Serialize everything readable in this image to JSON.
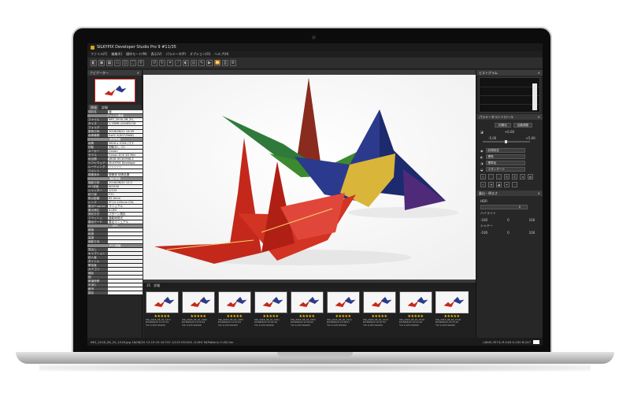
{
  "app": {
    "title": "SILKYPIX Developer Studio Pro 9  #11/35",
    "menu": [
      "ファイル(F)",
      "編集(E)",
      "操作モード(M)",
      "表示(V)",
      "パラメータ(P)",
      "オプション(O)",
      "ヘルプ(H)"
    ]
  },
  "left": {
    "navigator_title": "ナビゲーター",
    "tabs": [
      "情報",
      "詳細"
    ],
    "info": [
      {
        "k": "項目名",
        "v": "値"
      },
      {
        "section": "ファイル情報"
      },
      {
        "k": "ファイル",
        "v": "IMG_2018_08_20_"
      },
      {
        "k": "サイズ",
        "v": "2.30MB (24085216"
      },
      {
        "k": "フォルダ",
        "v": ""
      },
      {
        "k": "更新日時",
        "v": "2018/08/21 14:09"
      },
      {
        "k": "画像種類",
        "v": "Exif2.3(DCF/RAW)"
      },
      {
        "section": "基礎情報"
      },
      {
        "k": "画素",
        "v": "5616 x 3744 (マナ"
      },
      {
        "k": "回転",
        "v": "回転なし (1)"
      },
      {
        "k": "メーカー",
        "v": "Canon"
      },
      {
        "k": "モデル",
        "v": "Canon EOS 5D Mar"
      },
      {
        "k": "色空間",
        "v": "sRGB IEC61966-2"
      },
      {
        "k": "ソフトウェア",
        "v": "SILKYPIX Develope"
      },
      {
        "k": "レーティング",
        "v": "☆☆☆☆☆"
      },
      {
        "k": "コメント",
        "v": ""
      },
      {
        "k": "現像済み",
        "v": "現像済 特殊処置"
      },
      {
        "section": "撮影情報"
      },
      {
        "k": "撮影日時",
        "v": "2018/08/20 12:2"
      },
      {
        "k": "ISO感度",
        "v": "ISO200"
      },
      {
        "k": "シャッター",
        "v": "1/125"
      },
      {
        "k": "絞り値",
        "v": "F22"
      },
      {
        "k": "焦点距離",
        "v": "82.0mm"
      },
      {
        "k": "レンズ",
        "v": "EF24-105mm f/4L"
      },
      {
        "k": "露出Program",
        "v": "マニュアル"
      },
      {
        "k": "露出補正",
        "v": "0.0EV"
      },
      {
        "k": "測光方式",
        "v": "パターン測光"
      },
      {
        "k": "フラッシュ",
        "v": "撮影時発光"
      },
      {
        "k": "露出モード",
        "v": "露出マニュアル"
      },
      {
        "section": "GPS"
      },
      {
        "k": "緯度",
        "v": ""
      },
      {
        "k": "経度",
        "v": ""
      },
      {
        "k": "高度",
        "v": ""
      },
      {
        "k": "撮影方向",
        "v": ""
      },
      {
        "section": "IPTC情報"
      },
      {
        "k": "見出し",
        "v": ""
      },
      {
        "k": "キャプション",
        "v": ""
      },
      {
        "k": "記入者",
        "v": ""
      },
      {
        "k": "タイトル",
        "v": ""
      },
      {
        "k": "緊急度",
        "v": ""
      },
      {
        "k": "カテゴリ",
        "v": ""
      },
      {
        "k": "補足",
        "v": ""
      },
      {
        "k": "国",
        "v": ""
      },
      {
        "k": "都道府県",
        "v": ""
      },
      {
        "k": "市(町)",
        "v": ""
      },
      {
        "k": "都市",
        "v": ""
      },
      {
        "k": "国名",
        "v": ""
      }
    ]
  },
  "filmbar": [
    "35",
    "詳細"
  ],
  "filmstrip": [
    {
      "rating": "★★★★★",
      "line1": "IMG_2018_08_20_1471",
      "line2": "2018/08/20 11:47:24",
      "line3": "F22 1/125 ISO200",
      "selected": false
    },
    {
      "rating": "★★★★★",
      "line1": "IMG_2018_08_20_1482",
      "line2": "2018/08/20 11:50:44",
      "line3": "F22 1/125 ISO200",
      "selected": false
    },
    {
      "rating": "★★★★★",
      "line1": "IMG_2018_08_20_1483",
      "line2": "2018/08/20 11:51:04",
      "line3": "F22 1/125 ISO200",
      "selected": false
    },
    {
      "rating": "★★★★★",
      "line1": "IMG_2018_08_20_1501",
      "line2": "2018/08/20 12:02:10",
      "line3": "F22 1/125 ISO200",
      "selected": false
    },
    {
      "rating": "★★★★★",
      "line1": "IMG_2018_08_20_1505",
      "line2": "2018/08/20 12:04:02",
      "line3": "F22 1/125 ISO200",
      "selected": false
    },
    {
      "rating": "★★★★★",
      "line1": "IMG_2018_08_20_1511",
      "line2": "2018/08/20 12:06:07",
      "line3": "F22 1/125 ISO200",
      "selected": false
    },
    {
      "rating": "★★★★★",
      "line1": "IMG_2018_08_20_1513",
      "line2": "2018/08/20 12:07:53",
      "line3": "F22 1/125 ISO200",
      "selected": false
    },
    {
      "rating": "★★★★★",
      "line1": "IMG_2018_08_20_1516",
      "line2": "2018/08/20 12:15:19",
      "line3": "F22 1/125 ISO200",
      "selected": false
    },
    {
      "rating": "★★★★★",
      "line1": "IMG_2018_08_20_1518",
      "line2": "2018/08/20 12:15:19",
      "line3": "F22 1/125 ISO200",
      "selected": true
    }
  ],
  "right": {
    "histogram_title": "ヒストグラム",
    "params_title": "パラメータコントロール",
    "btn_a": "初期化",
    "btn_b": "自動調整",
    "exposure_left": "-5.00",
    "exposure_value": "+0.00",
    "exposure_right": "+5.00",
    "fields": [
      "記録設定",
      "標準",
      "標準色",
      "スタンダード"
    ],
    "tone_title": "露出・明るさ",
    "hdr_label": "HDR",
    "hdr_value": "0",
    "highlight_label": "ハイライト",
    "highlight_min": "-100",
    "highlight_value": "0",
    "highlight_max": "100",
    "shadow_label": "シャドー",
    "shadow_min": "-100",
    "shadow_value": "0",
    "shadow_max": "100"
  },
  "status": {
    "left": "IMG_2018_08_20_1518.jpg 18/08/20 12:15:19 16 F22 1/125 ISO200 -0.0EV M(Pattern) f=82.0m",
    "right": "(4845,3574)  R:248  G:250  B:247"
  }
}
